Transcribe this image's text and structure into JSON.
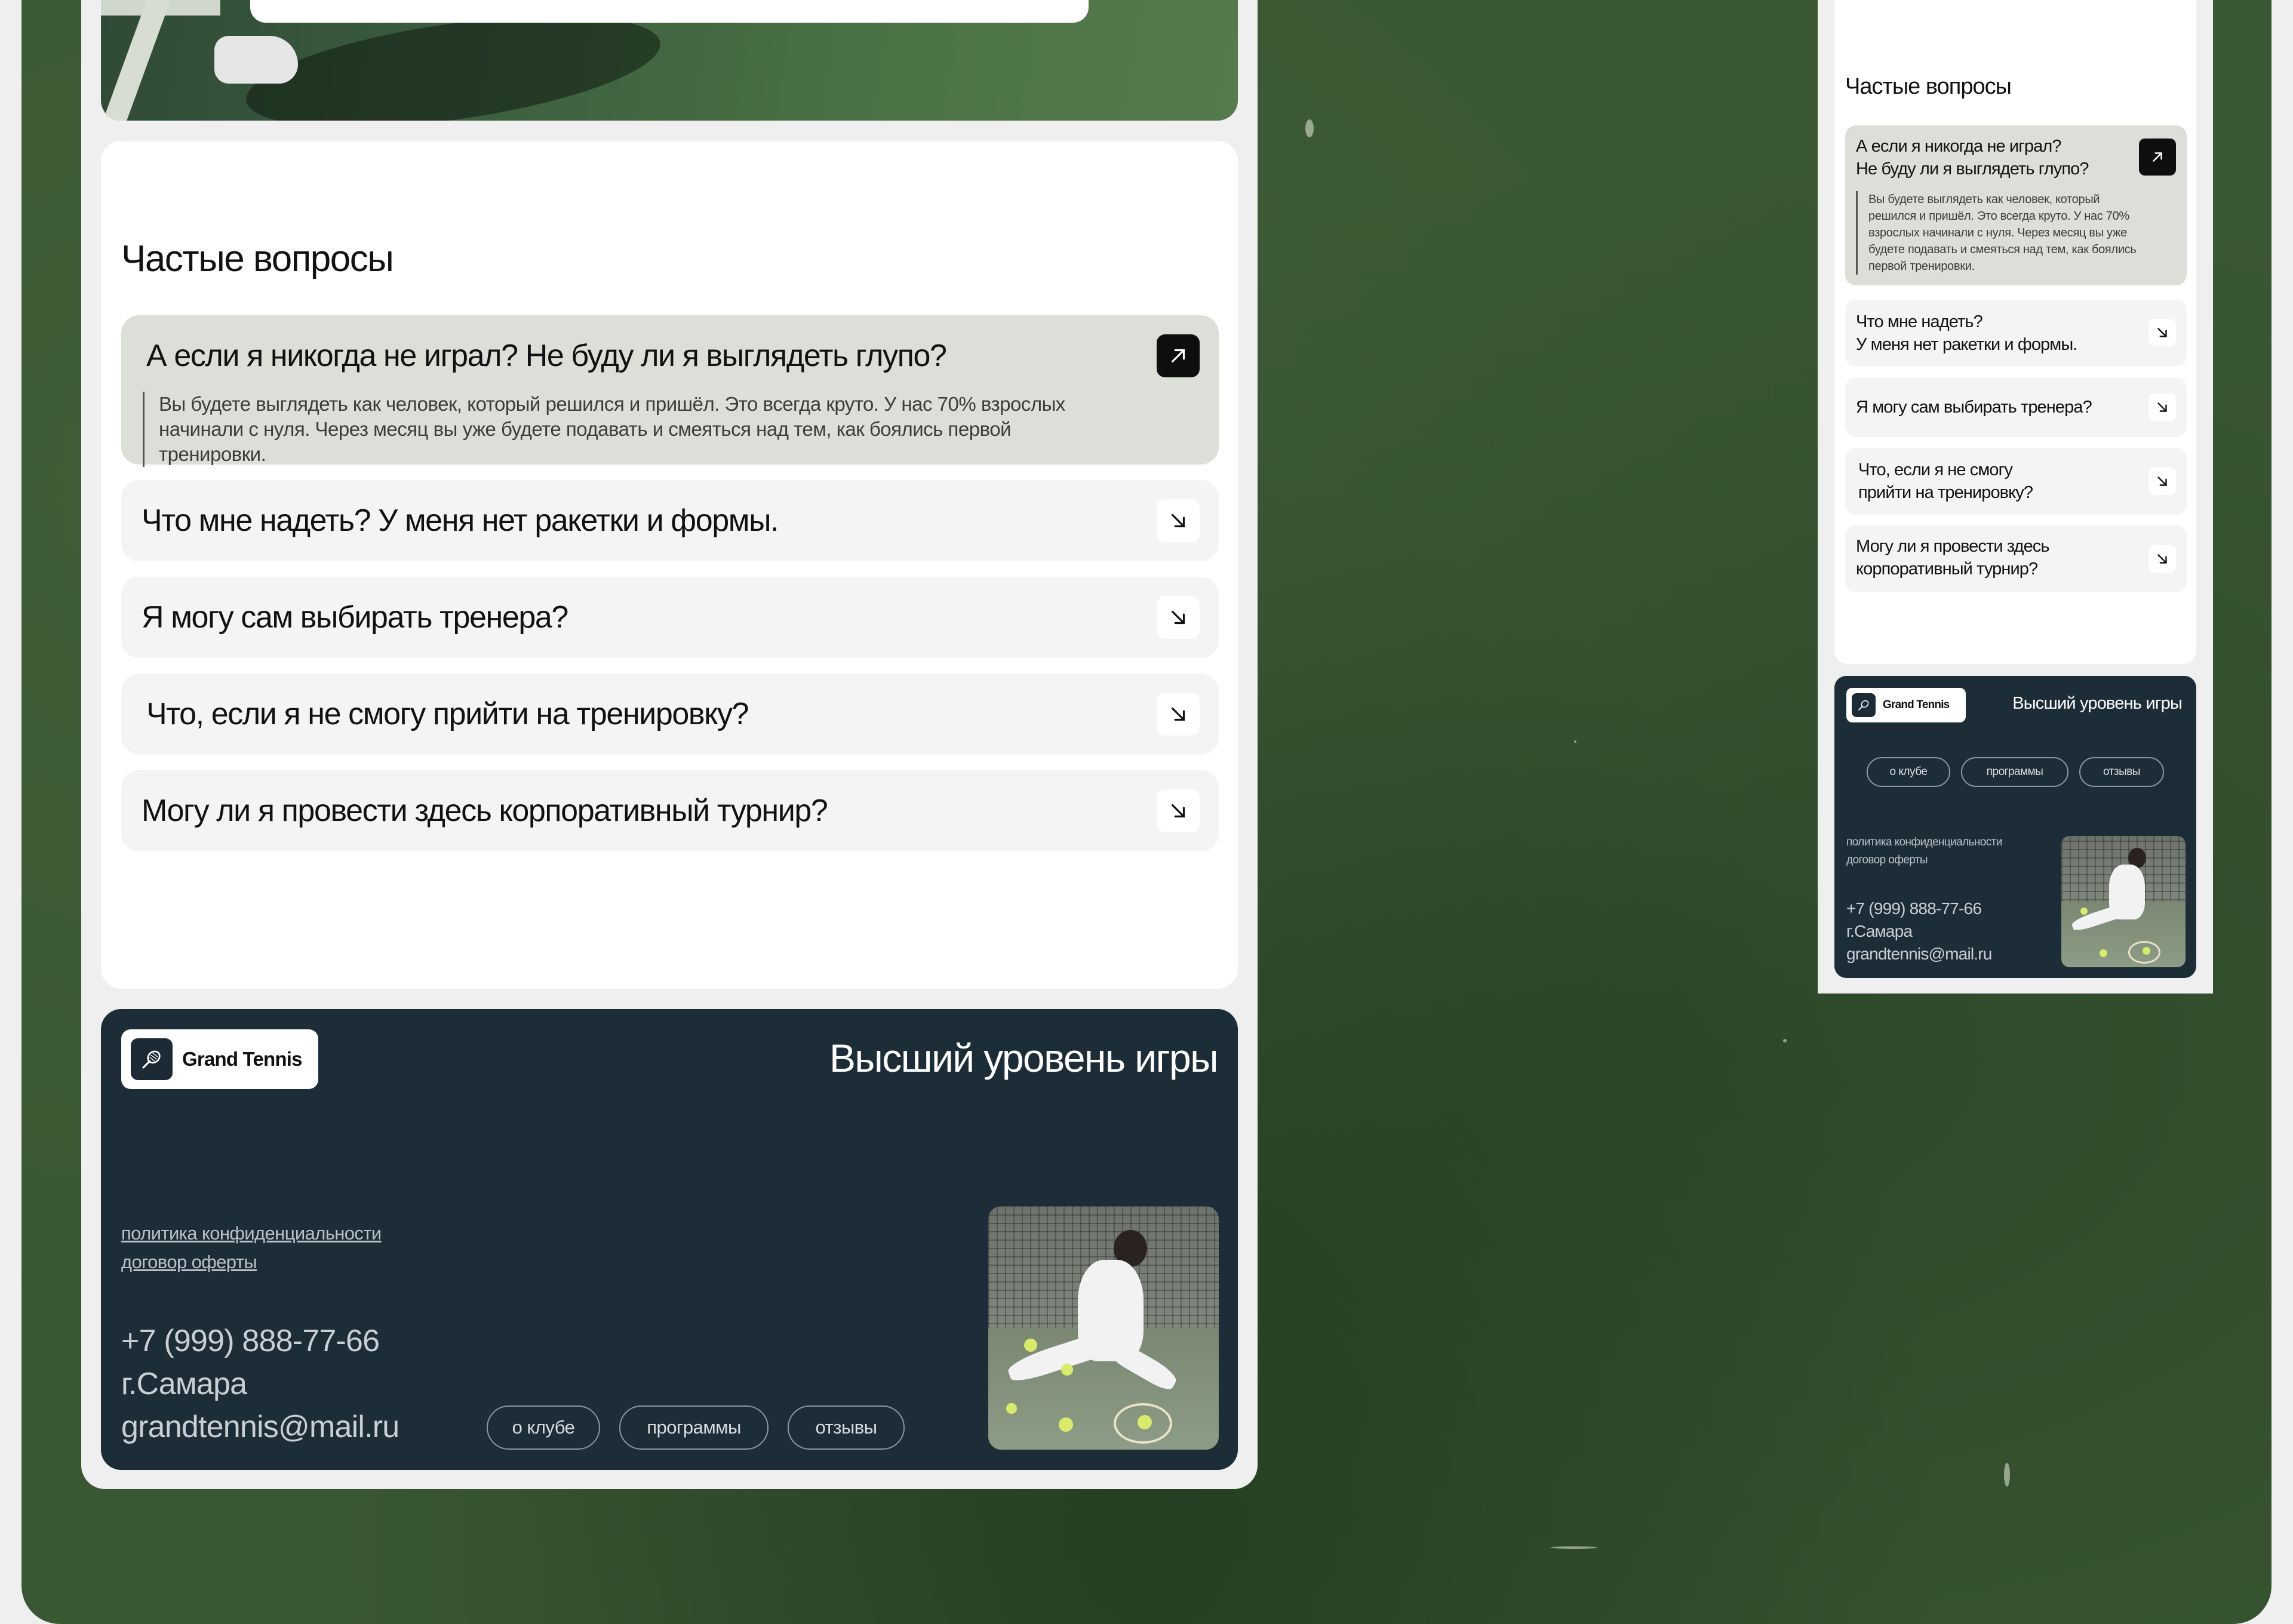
{
  "faq": {
    "title": "Частые вопросы",
    "items": [
      {
        "question": "А если я никогда не играл? Не буду ли я выглядеть глупо?",
        "question_mobile": "А если я никогда не играл?\nНе буду ли я выглядеть глупо?",
        "answer": "Вы будете выглядеть как человек, который решился и пришёл. Это всегда круто. У нас 70% взрослых начинали с нуля. Через месяц вы уже будете подавать и смеяться над тем, как боялись первой тренировки.",
        "answer_mobile": "Вы будете выглядеть как человек, который решился и пришёл. Это всегда круто. У нас 70% взрослых начинали с нуля. Через месяц вы уже будете подавать и смеяться над тем, как боялись первой тренировки.",
        "open": true
      },
      {
        "question": "Что мне надеть? У меня нет ракетки и формы.",
        "question_mobile": "Что мне надеть?\nУ меня нет ракетки и формы.",
        "open": false
      },
      {
        "question": "Я могу сам выбирать тренера?",
        "question_mobile": "Я могу сам выбирать тренера?",
        "open": false
      },
      {
        "question": "Что, если я не смогу прийти на тренировку?",
        "question_mobile": "Что, если я не смогу\nприйти на тренировку?",
        "open": false
      },
      {
        "question": "Могу ли я провести здесь корпоративный турнир?",
        "question_mobile": "Могу ли я провести здесь\nкорпоративный турнир?",
        "open": false
      }
    ]
  },
  "footer": {
    "brand": "Grand Tennis",
    "slogan": "Высший уровень игры",
    "links": [
      "политика конфиденциальности",
      "договор оферты"
    ],
    "phone": "+7 (999) 888-77-66",
    "city": "г.Самара",
    "email": "grandtennis@mail.ru",
    "nav": [
      "о клубе",
      "программы",
      "отзывы"
    ]
  },
  "icons": {
    "open": "arrow-up-right-icon",
    "closed": "arrow-down-right-icon",
    "logo": "tennis-racket-icon"
  },
  "colors": {
    "footer_bg": "#1d2d38",
    "open_item_bg": "#dcdfd7",
    "item_bg": "#f4f4f4",
    "grass": "#3a5733"
  }
}
